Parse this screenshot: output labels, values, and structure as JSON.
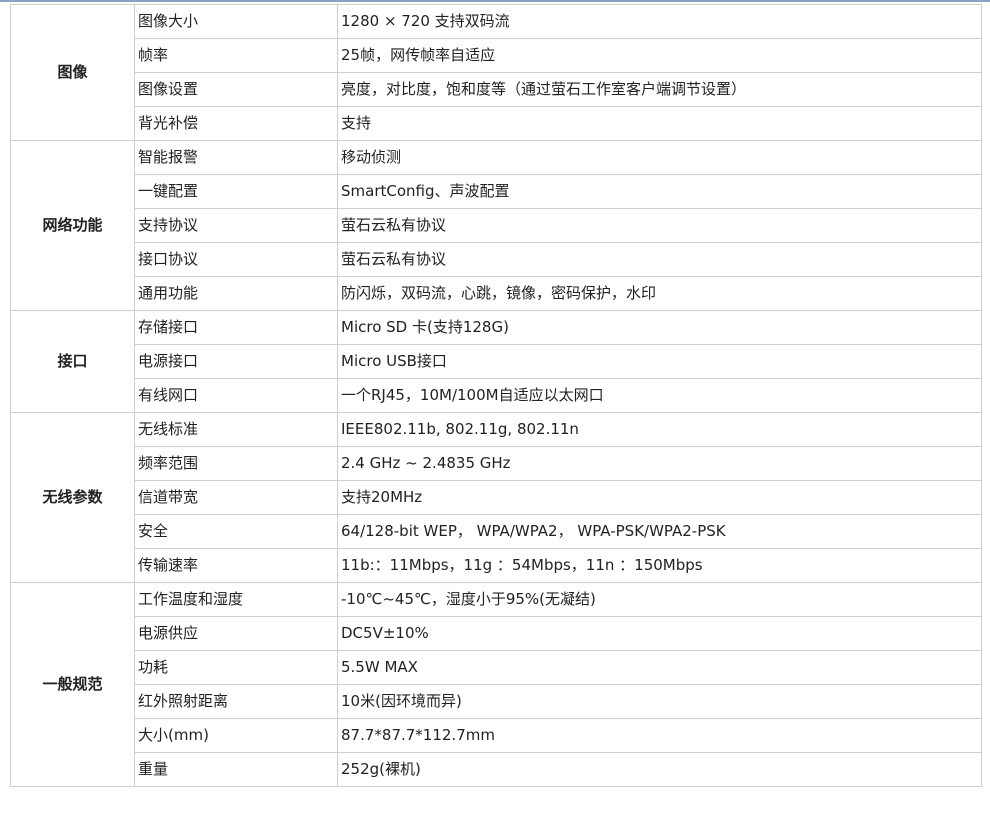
{
  "groups": [
    {
      "name": "图像",
      "rows": [
        {
          "label": "图像大小",
          "value": "1280 × 720 支持双码流"
        },
        {
          "label": "帧率",
          "value": "25帧，网传帧率自适应"
        },
        {
          "label": "图像设置",
          "value": "亮度，对比度，饱和度等（通过萤石工作室客户端调节设置）"
        },
        {
          "label": "背光补偿",
          "value": "支持"
        }
      ]
    },
    {
      "name": "网络功能",
      "rows": [
        {
          "label": "智能报警",
          "value": "移动侦测"
        },
        {
          "label": "一键配置",
          "value": "SmartConfig、声波配置"
        },
        {
          "label": "支持协议",
          "value": "萤石云私有协议"
        },
        {
          "label": "接口协议",
          "value": "萤石云私有协议"
        },
        {
          "label": "通用功能",
          "value": "防闪烁，双码流，心跳，镜像，密码保护，水印"
        }
      ]
    },
    {
      "name": "接口",
      "rows": [
        {
          "label": "存储接口",
          "value": "Micro SD 卡(支持128G)"
        },
        {
          "label": "电源接口",
          "value": "Micro USB接口"
        },
        {
          "label": "有线网口",
          "value": "一个RJ45，10M/100M自适应以太网口"
        }
      ]
    },
    {
      "name": "无线参数",
      "rows": [
        {
          "label": "无线标准",
          "value": "IEEE802.11b, 802.11g, 802.11n"
        },
        {
          "label": "频率范围",
          "value": "2.4 GHz ~ 2.4835 GHz"
        },
        {
          "label": "信道带宽",
          "value": "支持20MHz"
        },
        {
          "label": "安全",
          "value": "64/128-bit WEP， WPA/WPA2， WPA-PSK/WPA2-PSK"
        },
        {
          "label": "传输速率",
          "value": "11b:：11Mbps，11g ：54Mbps，11n ：150Mbps"
        }
      ]
    },
    {
      "name": "一般规范",
      "rows": [
        {
          "label": "工作温度和湿度",
          "value": "-10℃~45℃，湿度小于95%(无凝结)"
        },
        {
          "label": "电源供应",
          "value": "DC5V±10%"
        },
        {
          "label": "功耗",
          "value": "5.5W MAX"
        },
        {
          "label": "红外照射距离",
          "value": "10米(因环境而异)"
        },
        {
          "label": "大小(mm)",
          "value": "87.7*87.7*112.7mm"
        },
        {
          "label": "重量",
          "value": "252g(裸机)"
        }
      ]
    }
  ]
}
